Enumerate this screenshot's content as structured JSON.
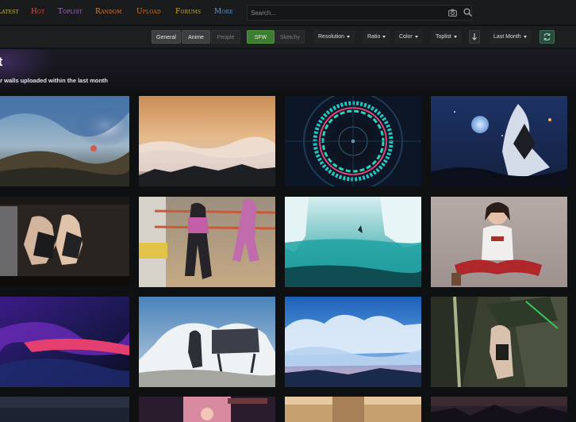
{
  "nav": {
    "items": [
      {
        "label": "Latest",
        "color": "#d2c44a"
      },
      {
        "label": "Hot",
        "color": "#e0504c"
      },
      {
        "label": "Toplist",
        "color": "#b06fd8"
      },
      {
        "label": "Random",
        "color": "#e07f3c"
      },
      {
        "label": "Upload",
        "color": "#d6752e"
      },
      {
        "label": "Forums",
        "color": "#c8b23a"
      },
      {
        "label": "More",
        "color": "#5f9ae0"
      }
    ]
  },
  "search": {
    "placeholder": "Search..."
  },
  "filters": {
    "categories": [
      "General",
      "Anime",
      "People"
    ],
    "purity": [
      "SFW",
      "Sketchy"
    ],
    "dropdowns": [
      "Resolution",
      "Ratio",
      "Color"
    ],
    "sorting": "Toplist",
    "range": "Last Month"
  },
  "page": {
    "title": "t",
    "subtitle": "ar walls uploaded within the last month"
  },
  "colors": {
    "accent_green": "#3e7c31",
    "refresh": "#2b4a3d",
    "background": "#0f1011"
  }
}
